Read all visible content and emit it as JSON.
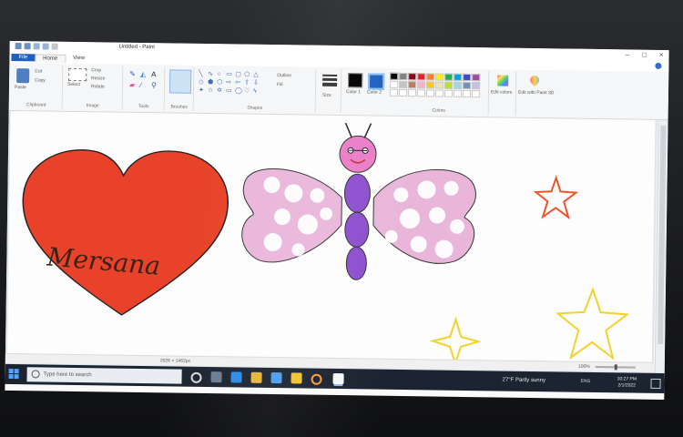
{
  "window": {
    "title": "Untitled - Paint"
  },
  "tabs": [
    {
      "label": "File"
    },
    {
      "label": "Home"
    },
    {
      "label": "View"
    }
  ],
  "ribbon": {
    "clipboard": {
      "label": "Clipboard",
      "paste": "Paste",
      "cut": "Cut",
      "copy": "Copy"
    },
    "image": {
      "label": "Image",
      "select": "Select",
      "crop": "Crop",
      "resize": "Resize",
      "rotate": "Rotate"
    },
    "tools": {
      "label": "Tools"
    },
    "brushes": {
      "label": "Brushes"
    },
    "shapes": {
      "label": "Shapes",
      "outline": "Outline",
      "fill": "Fill"
    },
    "size": {
      "label": "Size"
    },
    "color1": {
      "label": "Color 1"
    },
    "color2": {
      "label": "Color 2"
    },
    "colors": {
      "label": "Colors"
    },
    "edit_colors": {
      "label": "Edit colors"
    },
    "paint3d": {
      "label": "Edit with Paint 3D"
    }
  },
  "palette": [
    "#000000",
    "#7f7f7f",
    "#880015",
    "#ed1c24",
    "#ff7f27",
    "#fff200",
    "#22b14c",
    "#00a2e8",
    "#3f48cc",
    "#a349a4",
    "#ffffff",
    "#c3c3c3",
    "#b97a57",
    "#ffaec9",
    "#ffc90e",
    "#efe4b0",
    "#b5e61d",
    "#99d9ea",
    "#7092be",
    "#c8bfe7",
    "#ffffff",
    "#ffffff",
    "#ffffff",
    "#ffffff",
    "#ffffff",
    "#ffffff",
    "#ffffff",
    "#ffffff",
    "#ffffff",
    "#ffffff"
  ],
  "drawing": {
    "heart_text": "Mersana",
    "heart_color": "#e8432a",
    "butterfly_wing_color": "#e9b6da",
    "butterfly_body_color": "#8e4fcf",
    "butterfly_head_color": "#ea7ec7",
    "star_colors": [
      "#f0522a",
      "#f2d22c",
      "#f2d22c"
    ]
  },
  "statusbar": {
    "size": "2026 × 1462px",
    "zoom": "100%"
  },
  "taskbar": {
    "search_placeholder": "Type here to search",
    "weather": "27°F  Partly sunny",
    "lang": "ENG",
    "time": "10:27 PM",
    "date": "2/1/2022"
  }
}
